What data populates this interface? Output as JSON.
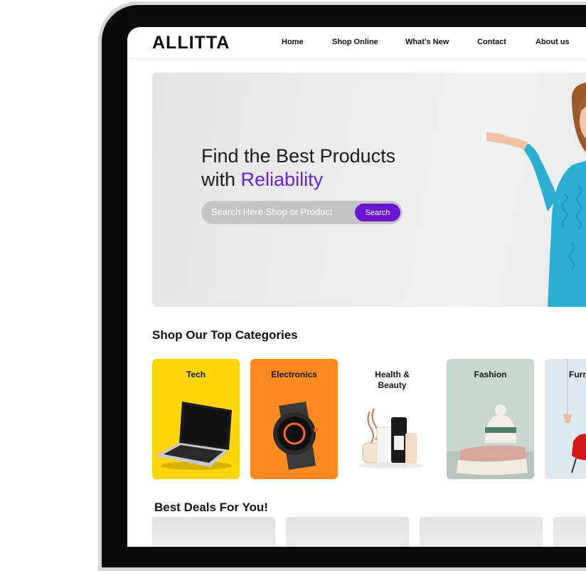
{
  "brand": {
    "logo": "ALLITTA"
  },
  "nav": {
    "items": [
      "Home",
      "Shop Online",
      "What's New",
      "Contact",
      "About us"
    ]
  },
  "hero": {
    "title_line1": "Find the Best Products",
    "title_line2_prefix": "with ",
    "title_line2_accent": "Reliability",
    "search_placeholder": "Search Here Shop or Product",
    "search_button": "Search",
    "accent_color": "#6a22d6"
  },
  "categories": {
    "title": "Shop Our Top Categories",
    "items": [
      {
        "label": "Tech",
        "color": "#ffd60a"
      },
      {
        "label": "Electronics",
        "color": "#ff8a1e"
      },
      {
        "label": "Health &\nBeauty",
        "color": "#ffffff"
      },
      {
        "label": "Fashion",
        "color": "#c9d8cf"
      },
      {
        "label": "Furn",
        "color": "#dfe8ee"
      }
    ]
  },
  "deals": {
    "title": "Best Deals For You!"
  }
}
